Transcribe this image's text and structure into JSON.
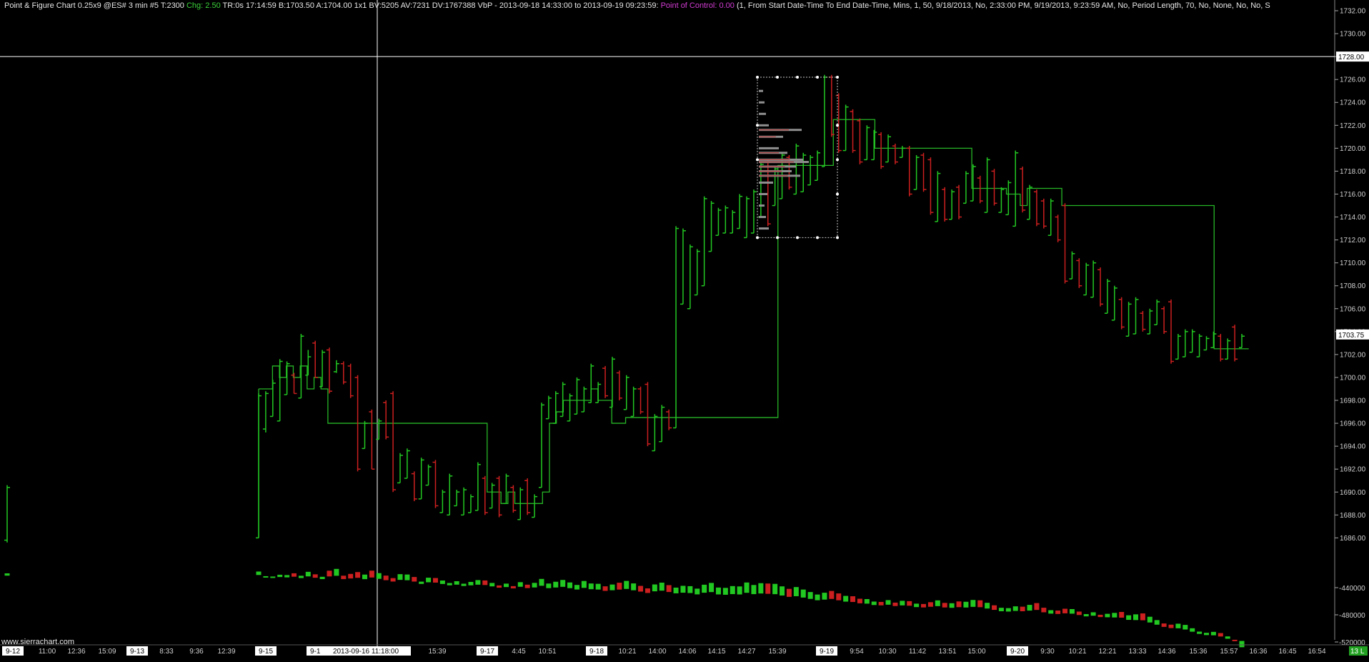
{
  "header": {
    "title": "Point & Figure Chart 0.25x9 @ES#",
    "interval": "3 min",
    "info1": "#5 T:2300",
    "chg": "Chg: 2.50",
    "info2": "TR:0s 17:14:59 B:1703.50 A:1704.00 1x1 BV:5205 AV:7231 DV:1767388 VbP - 2013-09-18  14:33:00 to 2013-09-19  09:23:59:",
    "poc": "Point of Control: 0.00",
    "params": "(1, From Start Date-Time To End Date-Time, Mins, 1, 50, 9/18/2013, No, 2:33:00 PM, 9/19/2013, 9:23:59 AM, No, Period Length, 70, No, None, No, No, S"
  },
  "watermark": "www.sierrachart.com",
  "colors": {
    "background": "#000000",
    "up": "#22c822",
    "down": "#cc1f1f",
    "step": "#26b526",
    "text": "#e6e6e6",
    "chg": "#3ad13a",
    "poc": "#d23cd2",
    "crosshair": "#ffffff",
    "vbp_box": "#c8c8c8"
  },
  "price_axis": {
    "labels": [
      "1732.00",
      "1730.00",
      "1728.00",
      "1726.00",
      "1724.00",
      "1722.00",
      "1720.00",
      "1718.00",
      "1716.00",
      "1714.00",
      "1712.00",
      "1710.00",
      "1708.00",
      "1706.00",
      "1704.00",
      "1702.00",
      "1700.00",
      "1698.00",
      "1696.00",
      "1694.00",
      "1692.00",
      "1690.00",
      "1688.00",
      "1686.00"
    ],
    "crosshair_value": "1728.00",
    "last_price": "1703.75"
  },
  "volume_axis": {
    "labels": [
      "-440000",
      "-480000",
      "-520000"
    ],
    "status": "13 L"
  },
  "time_axis": {
    "labels": [
      {
        "text": "9-12",
        "boxed": true
      },
      {
        "text": "11:00"
      },
      {
        "text": "12:36"
      },
      {
        "text": "15:09"
      },
      {
        "text": "9-13",
        "boxed": true
      },
      {
        "text": "8:33"
      },
      {
        "text": "9:36"
      },
      {
        "text": "12:39"
      },
      {
        "text": "9-15",
        "boxed": true
      },
      {
        "text": "9-16",
        "boxed": true
      },
      {
        "text": "2013-09-16  11:18:00",
        "boxed": true
      },
      {
        "text": "15:39"
      },
      {
        "text": "9-17",
        "boxed": true
      },
      {
        "text": "4:45"
      },
      {
        "text": "10:51"
      },
      {
        "text": "9-18",
        "boxed": true
      },
      {
        "text": "10:21"
      },
      {
        "text": "14:00"
      },
      {
        "text": "14:06"
      },
      {
        "text": "14:15"
      },
      {
        "text": "14:27"
      },
      {
        "text": "15:39"
      },
      {
        "text": "9-19",
        "boxed": true
      },
      {
        "text": "9:54"
      },
      {
        "text": "10:30"
      },
      {
        "text": "11:42"
      },
      {
        "text": "13:51"
      },
      {
        "text": "15:00"
      },
      {
        "text": "9-20",
        "boxed": true
      },
      {
        "text": "9:30"
      },
      {
        "text": "10:21"
      },
      {
        "text": "12:21"
      },
      {
        "text": "13:33"
      },
      {
        "text": "14:36"
      },
      {
        "text": "15:36"
      },
      {
        "text": "15:57"
      },
      {
        "text": "16:36"
      },
      {
        "text": "16:45"
      },
      {
        "text": "16:54"
      }
    ]
  },
  "chart_data": {
    "type": "bar",
    "bars": [
      [
        1685.6,
        1690.6,
        1685.8,
        1690.4
      ],
      [
        1686.0,
        1698.6,
        1686.0,
        1698.4
      ],
      [
        1695.2,
        1698.8,
        1695.5,
        1698.6
      ],
      [
        1696.6,
        1699.8,
        1696.6,
        1699.5
      ],
      [
        1696.2,
        1701.6,
        1696.2,
        1701.4
      ],
      [
        1698.5,
        1701.4,
        1698.5,
        1701.2
      ],
      [
        1698.6,
        1700.4,
        1700.2,
        1698.6
      ],
      [
        1698.2,
        1703.8,
        1698.2,
        1703.6
      ],
      [
        1700.2,
        1702.4,
        1700.2,
        1701.8
      ],
      [
        1700.0,
        1703.2,
        1703.0,
        1700.0
      ],
      [
        1699.2,
        1702.4,
        1699.2,
        1702.2
      ],
      [
        1698.6,
        1702.6,
        1702.4,
        1698.8
      ],
      [
        1700.4,
        1701.5,
        1700.5,
        1701.2
      ],
      [
        1699.4,
        1701.4,
        1701.2,
        1699.6
      ],
      [
        1698.2,
        1701.2,
        1701.0,
        1698.4
      ],
      [
        1691.8,
        1700.2,
        1700.0,
        1692.0
      ],
      [
        1693.8,
        1696.2,
        1693.8,
        1696.0
      ],
      [
        1692.0,
        1697.2,
        1697.0,
        1692.0
      ],
      [
        1694.6,
        1696.4,
        1694.6,
        1696.2
      ],
      [
        1694.6,
        1698.0,
        1697.8,
        1694.8
      ],
      [
        1690.0,
        1698.8,
        1698.6,
        1690.2
      ],
      [
        1690.8,
        1693.4,
        1690.8,
        1693.2
      ],
      [
        1691.2,
        1693.8,
        1691.2,
        1693.6
      ],
      [
        1689.2,
        1691.8,
        1691.6,
        1689.4
      ],
      [
        1689.4,
        1693.0,
        1689.4,
        1692.8
      ],
      [
        1690.6,
        1692.4,
        1690.6,
        1692.2
      ],
      [
        1688.6,
        1692.8,
        1692.6,
        1688.8
      ],
      [
        1688.2,
        1690.2,
        1688.2,
        1690.0
      ],
      [
        1688.0,
        1691.6,
        1688.0,
        1691.4
      ],
      [
        1688.8,
        1690.2,
        1688.8,
        1690.0
      ],
      [
        1688.0,
        1690.4,
        1688.0,
        1690.2
      ],
      [
        1688.2,
        1689.8,
        1688.2,
        1689.6
      ],
      [
        1688.4,
        1692.6,
        1688.4,
        1692.4
      ],
      [
        1688.0,
        1691.4,
        1691.2,
        1688.2
      ],
      [
        1688.6,
        1690.8,
        1688.6,
        1690.6
      ],
      [
        1687.8,
        1691.4,
        1691.2,
        1688.0
      ],
      [
        1689.0,
        1691.6,
        1689.0,
        1691.4
      ],
      [
        1688.2,
        1690.6,
        1690.4,
        1688.4
      ],
      [
        1687.6,
        1690.4,
        1687.6,
        1690.2
      ],
      [
        1688.0,
        1691.2,
        1691.0,
        1688.2
      ],
      [
        1687.8,
        1689.8,
        1687.8,
        1689.6
      ],
      [
        1690.4,
        1697.8,
        1690.4,
        1697.6
      ],
      [
        1696.4,
        1698.4,
        1696.4,
        1698.2
      ],
      [
        1696.0,
        1698.8,
        1696.0,
        1698.6
      ],
      [
        1696.6,
        1699.6,
        1696.6,
        1699.4
      ],
      [
        1696.2,
        1698.6,
        1696.2,
        1698.4
      ],
      [
        1696.8,
        1700.0,
        1696.8,
        1699.8
      ],
      [
        1697.0,
        1699.2,
        1697.0,
        1699.0
      ],
      [
        1697.8,
        1701.2,
        1697.8,
        1701.0
      ],
      [
        1697.8,
        1699.6,
        1697.8,
        1699.4
      ],
      [
        1698.2,
        1701.0,
        1700.8,
        1698.4
      ],
      [
        1697.4,
        1701.8,
        1697.4,
        1701.6
      ],
      [
        1698.0,
        1700.6,
        1700.4,
        1698.2
      ],
      [
        1697.2,
        1700.2,
        1697.2,
        1700.0
      ],
      [
        1696.6,
        1699.2,
        1696.6,
        1699.0
      ],
      [
        1696.8,
        1699.2,
        1699.0,
        1697.0
      ],
      [
        1694.0,
        1699.6,
        1699.4,
        1694.2
      ],
      [
        1693.6,
        1696.8,
        1693.6,
        1696.6
      ],
      [
        1694.4,
        1697.6,
        1694.4,
        1697.4
      ],
      [
        1695.4,
        1697.2,
        1697.0,
        1695.6
      ],
      [
        1695.6,
        1713.2,
        1695.6,
        1713.0
      ],
      [
        1706.4,
        1713.0,
        1706.4,
        1712.8
      ],
      [
        1706.0,
        1711.6,
        1706.0,
        1711.4
      ],
      [
        1707.2,
        1711.2,
        1707.2,
        1711.0
      ],
      [
        1708.0,
        1715.8,
        1708.0,
        1715.6
      ],
      [
        1711.0,
        1715.4,
        1711.0,
        1715.2
      ],
      [
        1712.4,
        1714.8,
        1712.4,
        1714.6
      ],
      [
        1712.6,
        1715.0,
        1712.6,
        1714.8
      ],
      [
        1712.6,
        1714.6,
        1712.6,
        1714.4
      ],
      [
        1713.0,
        1716.0,
        1713.0,
        1715.8
      ],
      [
        1712.2,
        1715.8,
        1712.2,
        1715.6
      ],
      [
        1712.6,
        1716.4,
        1712.6,
        1716.2
      ],
      [
        1714.0,
        1718.8,
        1714.0,
        1718.6
      ],
      [
        1713.2,
        1719.0,
        1719.0,
        1713.4
      ],
      [
        1715.0,
        1718.4,
        1715.0,
        1718.2
      ],
      [
        1715.6,
        1719.6,
        1715.6,
        1719.4
      ],
      [
        1716.4,
        1719.4,
        1719.2,
        1716.6
      ],
      [
        1716.0,
        1720.4,
        1716.0,
        1720.2
      ],
      [
        1716.2,
        1719.6,
        1716.2,
        1719.4
      ],
      [
        1716.8,
        1719.4,
        1716.8,
        1719.2
      ],
      [
        1717.2,
        1719.8,
        1717.2,
        1719.6
      ],
      [
        1718.4,
        1726.4,
        1718.4,
        1726.2
      ],
      [
        1721.0,
        1726.4,
        1726.2,
        1721.2
      ],
      [
        1719.6,
        1724.8,
        1724.6,
        1719.8
      ],
      [
        1719.8,
        1723.8,
        1719.8,
        1723.6
      ],
      [
        1719.6,
        1723.4,
        1723.2,
        1719.8
      ],
      [
        1718.6,
        1722.6,
        1722.4,
        1718.8
      ],
      [
        1719.0,
        1722.0,
        1719.0,
        1721.8
      ],
      [
        1719.0,
        1721.6,
        1719.0,
        1721.4
      ],
      [
        1718.2,
        1721.4,
        1721.2,
        1718.4
      ],
      [
        1718.8,
        1721.2,
        1718.8,
        1721.0
      ],
      [
        1718.6,
        1720.4,
        1720.2,
        1718.8
      ],
      [
        1719.2,
        1720.2,
        1719.2,
        1720.0
      ],
      [
        1715.8,
        1720.2,
        1720.0,
        1716.0
      ],
      [
        1716.4,
        1719.4,
        1716.4,
        1719.2
      ],
      [
        1716.2,
        1719.6,
        1719.4,
        1716.4
      ],
      [
        1714.2,
        1719.2,
        1719.0,
        1714.4
      ],
      [
        1713.6,
        1718.0,
        1713.6,
        1717.8
      ],
      [
        1713.6,
        1716.6,
        1716.4,
        1713.8
      ],
      [
        1713.8,
        1716.4,
        1713.8,
        1716.2
      ],
      [
        1713.8,
        1716.8,
        1716.6,
        1714.0
      ],
      [
        1715.2,
        1718.0,
        1715.2,
        1717.8
      ],
      [
        1715.4,
        1718.6,
        1715.4,
        1718.4
      ],
      [
        1715.2,
        1717.6,
        1717.4,
        1715.4
      ],
      [
        1714.4,
        1719.2,
        1714.4,
        1719.0
      ],
      [
        1715.0,
        1718.2,
        1718.0,
        1715.2
      ],
      [
        1714.4,
        1716.6,
        1714.4,
        1716.4
      ],
      [
        1714.2,
        1717.2,
        1714.2,
        1717.0
      ],
      [
        1713.2,
        1719.8,
        1713.2,
        1719.6
      ],
      [
        1714.4,
        1718.4,
        1718.2,
        1714.6
      ],
      [
        1713.8,
        1716.8,
        1713.8,
        1716.6
      ],
      [
        1713.2,
        1716.4,
        1716.2,
        1713.4
      ],
      [
        1713.0,
        1715.6,
        1715.4,
        1713.2
      ],
      [
        1712.4,
        1715.6,
        1712.4,
        1715.4
      ],
      [
        1711.8,
        1714.2,
        1714.0,
        1712.0
      ],
      [
        1708.2,
        1715.2,
        1715.0,
        1708.4
      ],
      [
        1708.6,
        1711.0,
        1708.6,
        1710.8
      ],
      [
        1707.8,
        1710.4,
        1710.2,
        1708.0
      ],
      [
        1707.2,
        1710.0,
        1707.2,
        1709.8
      ],
      [
        1707.0,
        1710.2,
        1707.0,
        1710.0
      ],
      [
        1706.2,
        1709.6,
        1709.4,
        1706.4
      ],
      [
        1705.6,
        1708.6,
        1705.6,
        1708.4
      ],
      [
        1705.0,
        1708.0,
        1705.0,
        1707.8
      ],
      [
        1704.2,
        1707.0,
        1706.8,
        1704.4
      ],
      [
        1703.6,
        1706.6,
        1703.6,
        1706.4
      ],
      [
        1703.8,
        1707.0,
        1703.8,
        1706.8
      ],
      [
        1704.0,
        1705.8,
        1705.6,
        1704.2
      ],
      [
        1703.8,
        1706.0,
        1703.8,
        1705.8
      ],
      [
        1704.6,
        1706.8,
        1704.6,
        1706.6
      ],
      [
        1703.8,
        1706.2,
        1706.0,
        1704.0
      ],
      [
        1701.2,
        1706.8,
        1706.6,
        1701.4
      ],
      [
        1701.6,
        1703.8,
        1701.6,
        1703.6
      ],
      [
        1701.8,
        1704.2,
        1701.8,
        1704.0
      ],
      [
        1702.2,
        1704.2,
        1702.2,
        1704.0
      ],
      [
        1701.8,
        1703.8,
        1701.8,
        1703.6
      ],
      [
        1702.4,
        1703.6,
        1702.4,
        1703.4
      ],
      [
        1702.6,
        1704.0,
        1702.6,
        1703.8
      ],
      [
        1701.4,
        1703.8,
        1703.6,
        1701.6
      ],
      [
        1701.6,
        1703.4,
        1701.6,
        1703.2
      ],
      [
        1701.4,
        1704.6,
        1704.4,
        1701.6
      ],
      [
        1702.6,
        1703.8,
        1702.6,
        1703.6
      ]
    ],
    "step_line": [
      1699,
      1699,
      1701,
      1700,
      1701,
      1700,
      1701,
      1699,
      1700,
      1699,
      1696,
      1696,
      1696,
      1696,
      1696,
      1696,
      1696,
      1696,
      1696,
      1696,
      1696,
      1696,
      1696,
      1696,
      1696,
      1696,
      1696,
      1696,
      1696,
      1696,
      1696,
      1696,
      1696,
      1690,
      1690,
      1689,
      1690,
      1689,
      1689,
      1689,
      1689,
      1690,
      1696,
      1697,
      1698,
      1698,
      1698,
      1698,
      1699,
      1698,
      1698,
      1696,
      1696,
      1696.5,
      1696.5,
      1696.5,
      1696.5,
      1696.5,
      1696.5,
      1696.5,
      1696.5,
      1696.5,
      1696.5,
      1696.5,
      1696.5,
      1696.5,
      1696.5,
      1696.5,
      1696.5,
      1696.5,
      1696.5,
      1696.5,
      1696.5,
      1696.5,
      1696.5,
      1718.5,
      1718.5,
      1718.5,
      1718.5,
      1718.5,
      1718.5,
      1718.5,
      1718.5,
      1722.5,
      1722.5,
      1722.5,
      1722.5,
      1722.5,
      1722.5,
      1720.0,
      1720.0,
      1720.0,
      1720.0,
      1720.0,
      1720.0,
      1720.0,
      1720.0,
      1720.0,
      1720.0,
      1720.0,
      1720.0,
      1720.0,
      1720.0,
      1716.5,
      1716.5,
      1716.5,
      1716.5,
      1716.5,
      1716.0,
      1716.0,
      1715.0,
      1716.5,
      1716.5,
      1716.5,
      1716.5,
      1716.5,
      1715.0,
      1715.0,
      1715.0,
      1715.0,
      1715.0,
      1715.0,
      1715.0,
      1715.0,
      1715.0,
      1715.0,
      1715.0,
      1715.0,
      1715.0,
      1715.0,
      1715.0,
      1715.0,
      1715.0,
      1715.0,
      1715.0,
      1715.0,
      1715.0,
      1715.0,
      1702.5,
      1702.5,
      1702.5,
      1702.5,
      1702.5
    ],
    "volume": [
      2,
      3,
      1,
      1,
      2,
      2,
      3,
      2,
      4,
      3,
      2,
      5,
      6,
      3,
      4,
      5,
      4,
      6,
      5,
      4,
      3,
      5,
      5,
      4,
      2,
      4,
      4,
      3,
      2,
      3,
      2,
      3,
      4,
      4,
      3,
      2,
      3,
      2,
      4,
      3,
      4,
      6,
      4,
      5,
      6,
      5,
      4,
      6,
      5,
      5,
      4,
      5,
      6,
      7,
      6,
      5,
      4,
      6,
      7,
      6,
      5,
      6,
      6,
      5,
      7,
      8,
      6,
      6,
      7,
      7,
      9,
      8,
      9,
      9,
      9,
      8,
      7,
      8,
      7,
      6,
      5,
      6,
      7,
      6,
      5,
      5,
      4,
      4,
      3,
      3,
      4,
      3,
      4,
      4,
      3,
      3,
      4,
      5,
      4,
      4,
      5,
      5,
      6,
      6,
      5,
      4,
      3,
      3,
      4,
      4,
      5,
      6,
      4,
      3,
      3,
      4,
      4,
      3,
      2,
      3,
      2,
      3,
      4,
      5,
      4,
      5,
      6,
      5,
      4,
      3,
      3,
      4,
      4,
      3,
      2,
      2,
      3,
      3,
      2,
      1,
      1,
      1,
      1,
      1,
      1
    ]
  }
}
